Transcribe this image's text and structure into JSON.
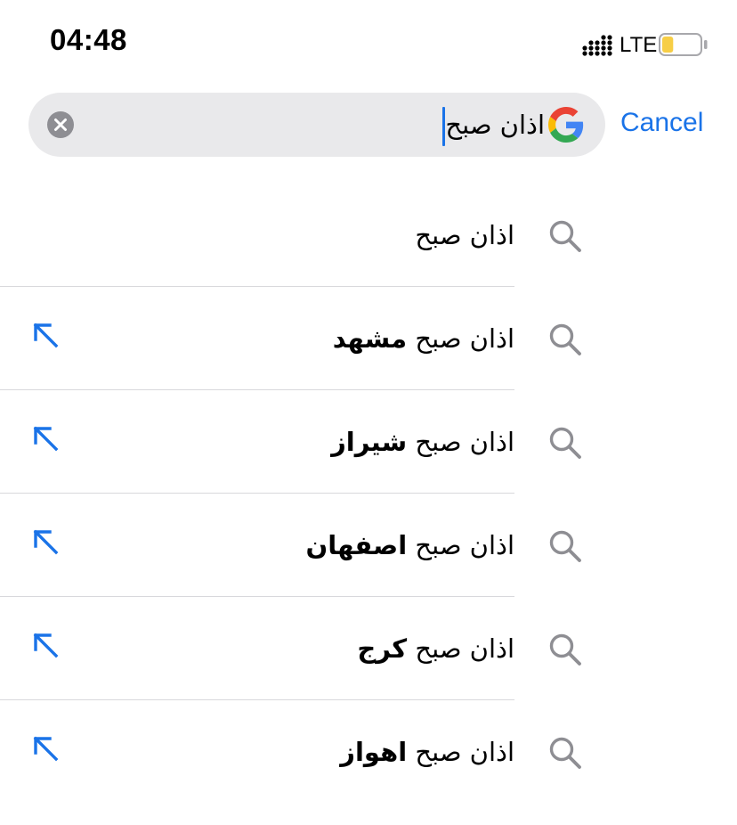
{
  "status_bar": {
    "time": "04:48",
    "network": "LTE",
    "battery_level": 0.3,
    "battery_color": "#f7ce46"
  },
  "search": {
    "query": "اذان صبح",
    "clear_icon": "clear-circle-icon",
    "engine_logo": "google-logo",
    "cancel_label": "Cancel",
    "accent_color": "#1a73e8"
  },
  "suggestions": [
    {
      "base": "اذان صبح",
      "completion": "",
      "has_fill_arrow": false
    },
    {
      "base": "اذان صبح ",
      "completion": "مشهد",
      "has_fill_arrow": true
    },
    {
      "base": "اذان صبح ",
      "completion": "شیراز",
      "has_fill_arrow": true
    },
    {
      "base": "اذان صبح ",
      "completion": "اصفهان",
      "has_fill_arrow": true
    },
    {
      "base": "اذان صبح ",
      "completion": "کرج",
      "has_fill_arrow": true
    },
    {
      "base": "اذان صبح ",
      "completion": "اهواز",
      "has_fill_arrow": true
    }
  ]
}
